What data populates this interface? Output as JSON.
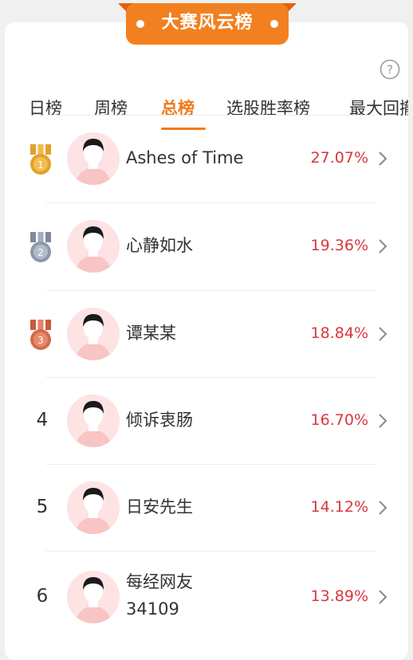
{
  "banner": {
    "title": "大赛风云榜"
  },
  "tabs": [
    {
      "label": "日榜",
      "active": false
    },
    {
      "label": "周榜",
      "active": false
    },
    {
      "label": "总榜",
      "active": true
    },
    {
      "label": "选股胜率榜",
      "active": false
    },
    {
      "label": "最大回撤",
      "active": false
    }
  ],
  "colors": {
    "accent": "#f07a1a",
    "positive": "#d9363e",
    "gold": "#e2a12d",
    "silver": "#8c98a8",
    "bronze": "#d46a4c"
  },
  "rows": [
    {
      "rank": "1",
      "medal": "gold",
      "name": "Ashes of Time",
      "pct": "27.07%"
    },
    {
      "rank": "2",
      "medal": "silver",
      "name": "心静如水",
      "pct": "19.36%"
    },
    {
      "rank": "3",
      "medal": "bronze",
      "name": "谭某某",
      "pct": "18.84%"
    },
    {
      "rank": "4",
      "medal": "",
      "name": "倾诉衷肠",
      "pct": "16.70%"
    },
    {
      "rank": "5",
      "medal": "",
      "name": "日安先生",
      "pct": "14.12%"
    },
    {
      "rank": "6",
      "medal": "",
      "name": "每经网友",
      "name2": "34109",
      "pct": "13.89%"
    }
  ]
}
